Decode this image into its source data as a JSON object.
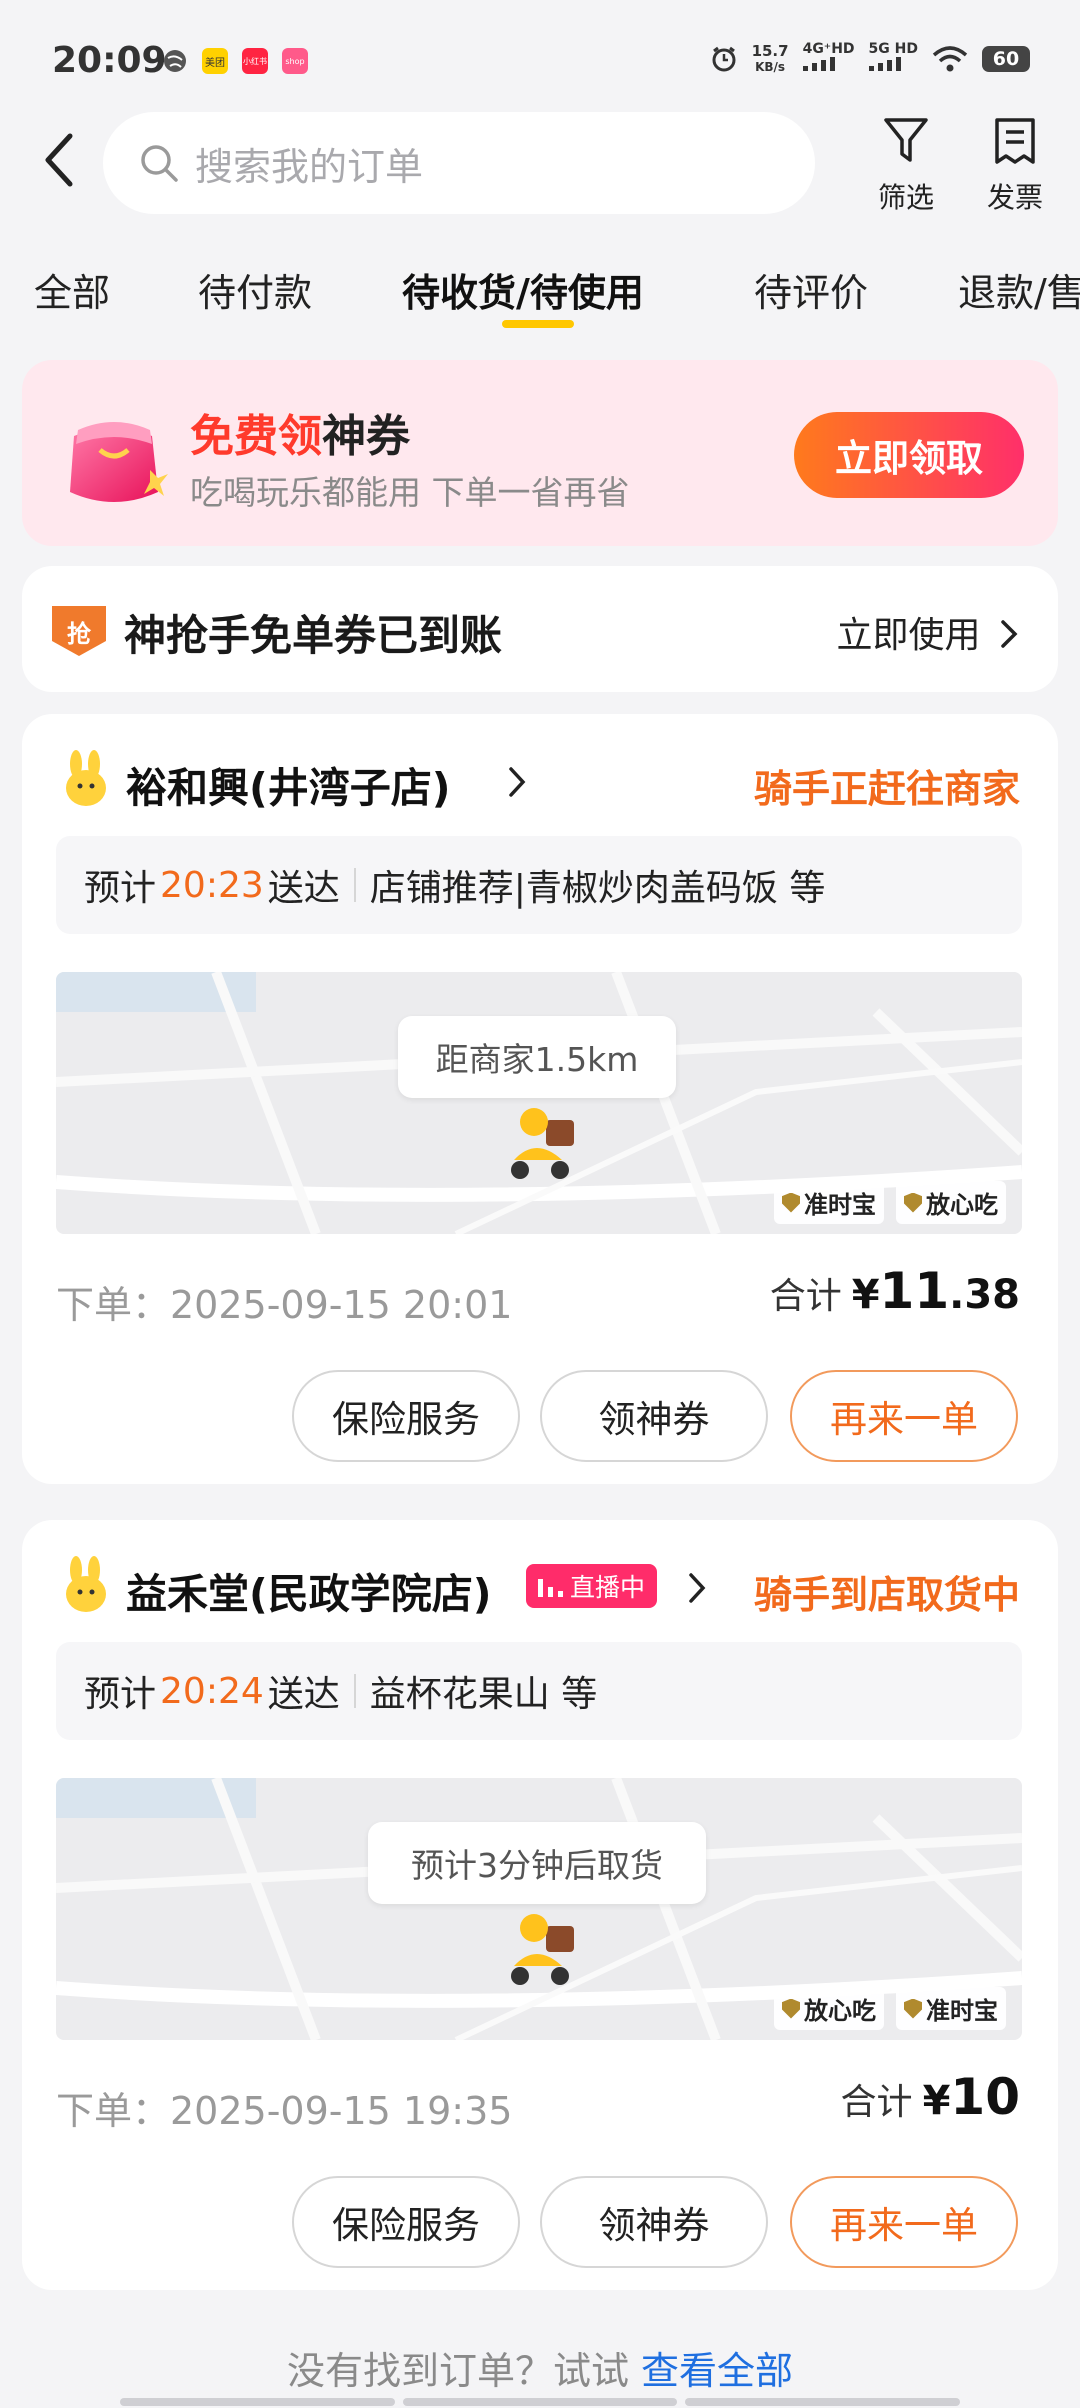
{
  "status_bar": {
    "time": "20:09",
    "apps": [
      {
        "name": "meituan-app-icon",
        "label": "美团",
        "color": "#ffd100"
      },
      {
        "name": "xiaohongshu-app-icon",
        "label": "小红书",
        "color": "#ff2442"
      },
      {
        "name": "shopping-app-icon",
        "label": "shop",
        "color": "#ff5a8a"
      }
    ],
    "speed_value": "15.7",
    "speed_unit": "KB/s",
    "net1": "4G⁺HD",
    "net2": "5G HD",
    "battery": "60"
  },
  "header": {
    "search_placeholder": "搜索我的订单",
    "filter_label": "筛选",
    "invoice_label": "发票"
  },
  "tabs": [
    {
      "label": "全部"
    },
    {
      "label": "待付款"
    },
    {
      "label": "待收货/待使用",
      "active": true
    },
    {
      "label": "待评价"
    },
    {
      "label": "退款/售"
    }
  ],
  "promo": {
    "title_highlight": "免费领",
    "title_rest": "神券",
    "subtitle": "吃喝玩乐都能用 下单一省再省",
    "button": "立即领取"
  },
  "coupon_banner": {
    "badge": "抢",
    "text": "神抢手免单券已到账",
    "link": "立即使用"
  },
  "orders": [
    {
      "shop": "裕和興(井湾子店)",
      "live": "",
      "status": "骑手正赶往商家",
      "eta_prefix": "预计",
      "eta_time": "20:23",
      "eta_suffix": "送达",
      "items": "店铺推荐|青椒炒肉盖码饭 等",
      "map_bubble": "距商家1.5km",
      "tags": [
        "准时宝",
        "放心吃"
      ],
      "order_time": "下单：2025-09-15 20:01",
      "total_label": "合计",
      "currency": "¥",
      "total_int": "11",
      "total_dec": ".38",
      "buttons": [
        "保险服务",
        "领神券",
        "再来一单"
      ]
    },
    {
      "shop": "益禾堂(民政学院店)",
      "live": "直播中",
      "status": "骑手到店取货中",
      "eta_prefix": "预计",
      "eta_time": "20:24",
      "eta_suffix": "送达",
      "items": "益杯花果山 等",
      "map_bubble": "预计3分钟后取货",
      "tags": [
        "放心吃",
        "准时宝"
      ],
      "order_time": "下单：2025-09-15 19:35",
      "total_label": "合计",
      "currency": "¥",
      "total_int": "10",
      "total_dec": "",
      "buttons": [
        "保险服务",
        "领神券",
        "再来一单"
      ]
    }
  ],
  "footer": {
    "text": "没有找到订单？试试",
    "link": "查看全部"
  }
}
